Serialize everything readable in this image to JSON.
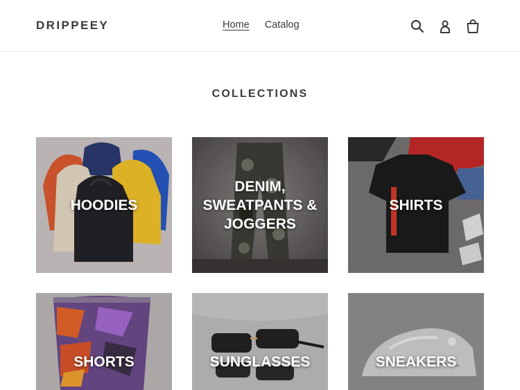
{
  "header": {
    "logo": "DRIPPEEY",
    "nav": [
      {
        "label": "Home",
        "active": true
      },
      {
        "label": "Catalog",
        "active": false
      }
    ],
    "icons": [
      "search-icon",
      "account-icon",
      "cart-icon"
    ]
  },
  "main": {
    "title": "COLLECTIONS",
    "collections": [
      {
        "label": "HOODIES"
      },
      {
        "label": "DENIM, SWEATPANTS & JOGGERS"
      },
      {
        "label": "SHIRTS"
      },
      {
        "label": "SHORTS"
      },
      {
        "label": "SUNGLASSES"
      },
      {
        "label": "SNEAKERS"
      }
    ]
  },
  "colors": {
    "text": "#3a3a3a",
    "border": "#e8e8e8",
    "overlay_text": "#ffffff"
  }
}
